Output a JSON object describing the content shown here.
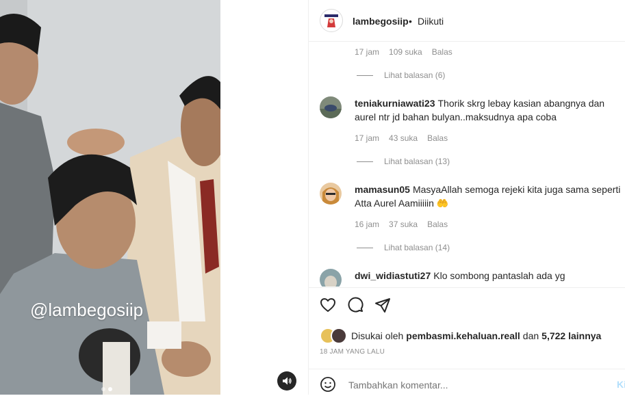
{
  "media": {
    "watermark": "@lambegosiip",
    "slides": 2,
    "active_slide": 2
  },
  "header": {
    "username": "lambegosiip",
    "separator": "•",
    "follow_status": "Diikuti"
  },
  "comments": [
    {
      "partial": true,
      "time": "17 jam",
      "likes": "109 suka",
      "reply": "Balas",
      "view_replies": "Lihat balasan (6)"
    },
    {
      "username": "teniakurniawati23",
      "text": "Thorik skrg lebay kasian abangnya dan aurel ntr jd bahan bulyan..maksudnya apa coba",
      "time": "17 jam",
      "likes": "43 suka",
      "reply": "Balas",
      "view_replies": "Lihat balasan (13)"
    },
    {
      "username": "mamasun05",
      "text": "MasyaAllah semoga rejeki kita juga sama seperti Atta Aurel Aamiiiiin 🤲",
      "time": "16 jam",
      "likes": "37 suka",
      "reply": "Balas",
      "view_replies": "Lihat balasan (14)"
    },
    {
      "username": "dwi_widiastuti27",
      "text": "Klo sombong pantaslah ada yg"
    }
  ],
  "likes": {
    "prefix": "Disukai oleh",
    "user": "pembasmi.kehaluan.reall",
    "and": "dan",
    "others": "5,722 lainnya"
  },
  "timestamp": "18 JAM YANG LALU",
  "add_comment": {
    "placeholder": "Tambahkan komentar...",
    "post": "Ki"
  },
  "colors": {
    "text": "#262626",
    "muted": "#8e8e8e",
    "border": "#efefef",
    "post_disabled": "#b2dffc"
  }
}
